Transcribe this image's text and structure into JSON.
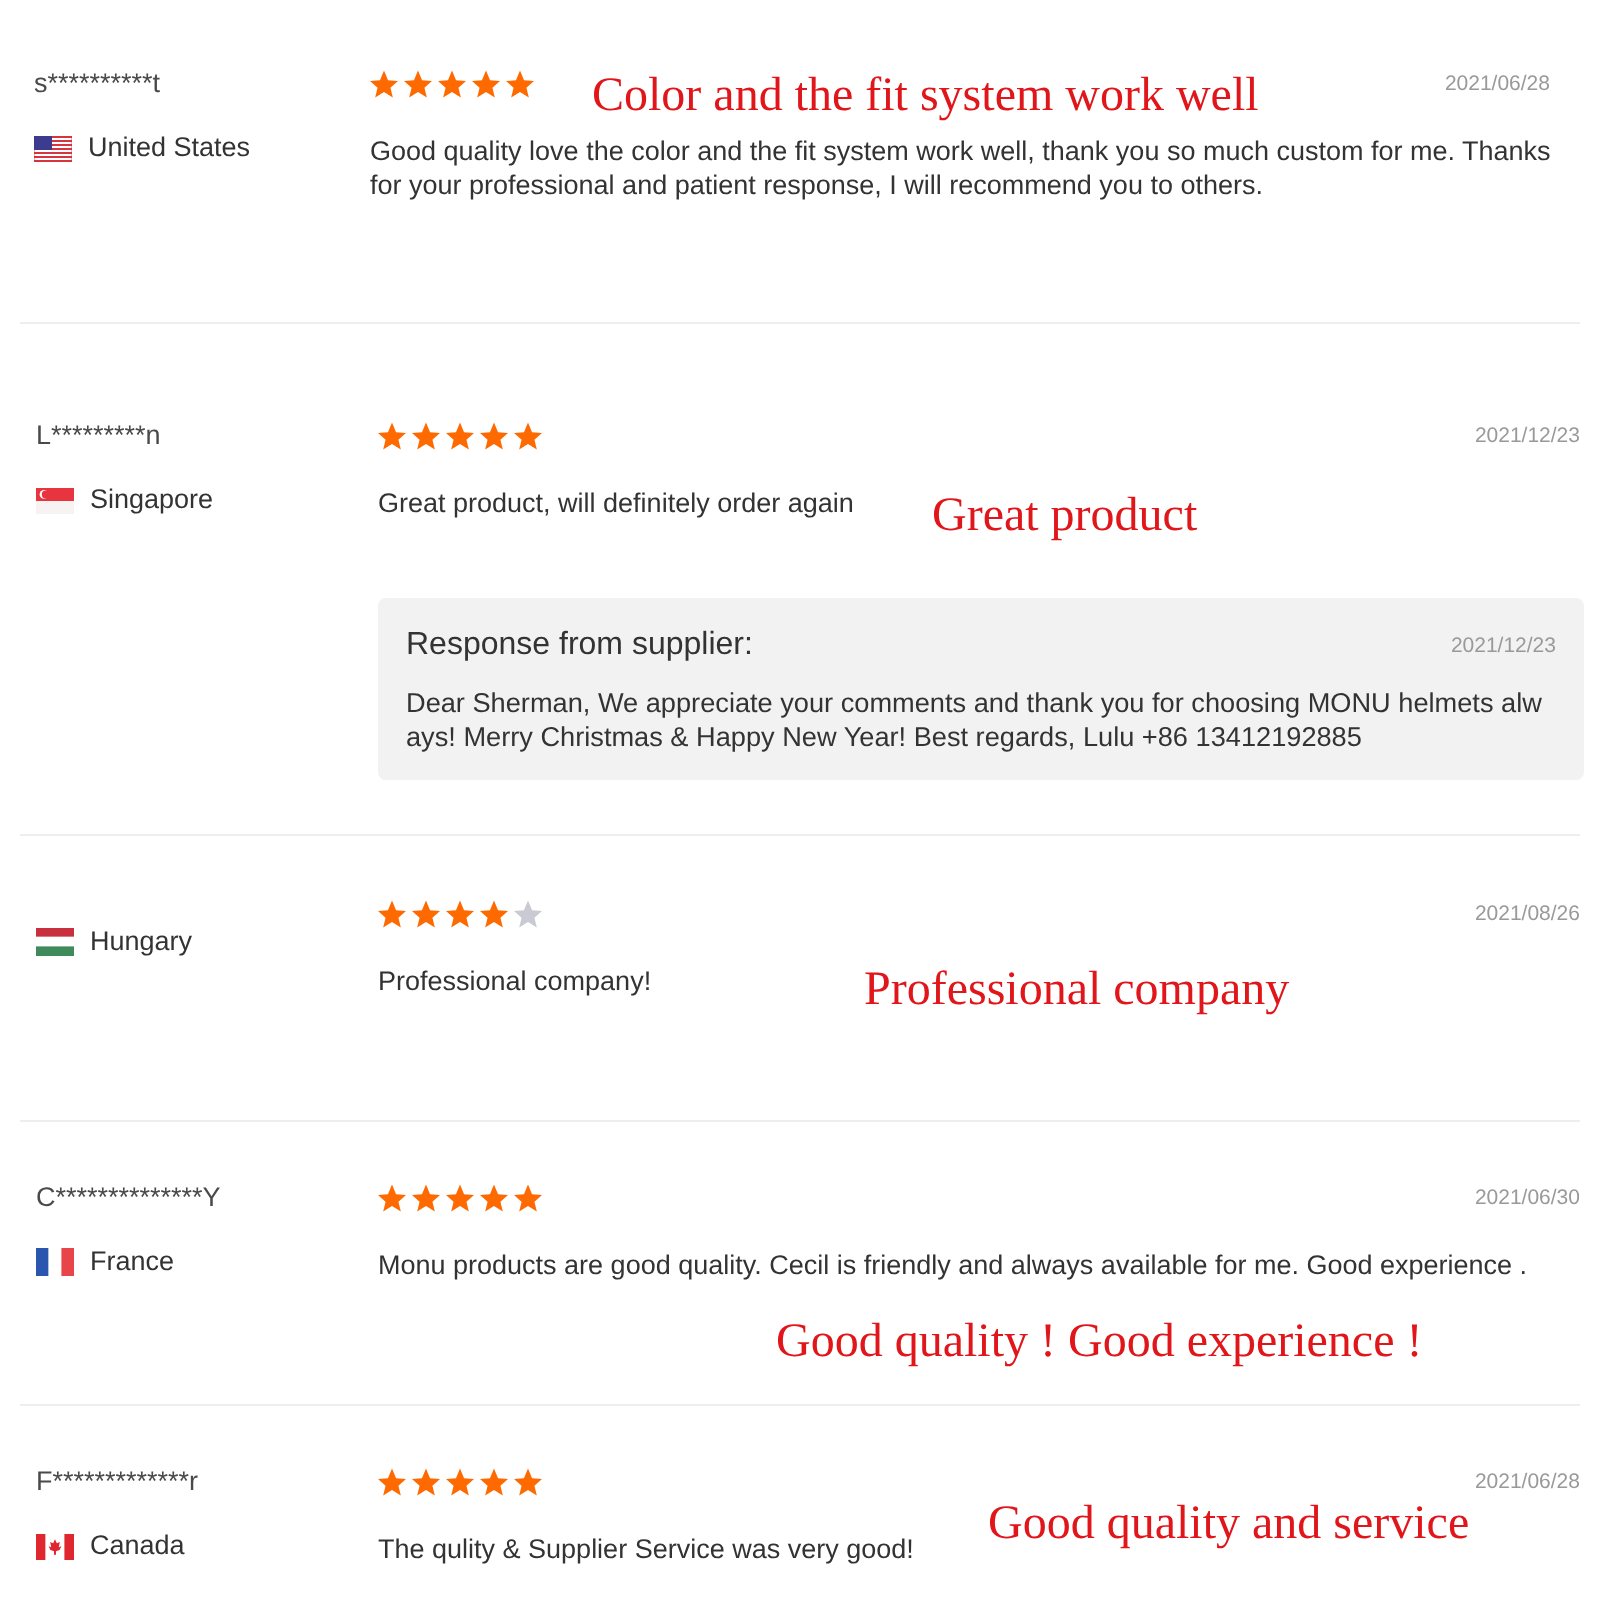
{
  "reviews": [
    {
      "name": "s**********t",
      "country": "United States",
      "stars": 5,
      "date": "2021/06/28",
      "text": "Good quality love the color and the fit system work well, thank you so much custom for me. Thanks for your professional and patient response, I will recommend you to others.",
      "annotation": "Color and the fit system work well"
    },
    {
      "name": "L*********n",
      "country": "Singapore",
      "stars": 5,
      "date": "2021/12/23",
      "text": "Great product, will definitely order again",
      "annotation": "Great product",
      "response": {
        "title": "Response from supplier:",
        "date": "2021/12/23",
        "text": "Dear Sherman, We appreciate your comments and thank you for choosing MONU helmets always! Merry Christmas & Happy New Year! Best regards, Lulu +86 13412192885"
      }
    },
    {
      "country": "Hungary",
      "stars": 4,
      "date": "2021/08/26",
      "text": "Professional company!",
      "annotation": "Professional company"
    },
    {
      "name": "C**************Y",
      "country": "France",
      "stars": 5,
      "date": "2021/06/30",
      "text": "Monu products are good quality. Cecil is friendly and always available for me. Good experience .",
      "annotation": "Good quality ! Good experience !"
    },
    {
      "name": "F*************r",
      "country": "Canada",
      "stars": 5,
      "date": "2021/06/28",
      "text": "The qulity & Supplier Service was very good!",
      "annotation": "Good quality and service"
    }
  ]
}
